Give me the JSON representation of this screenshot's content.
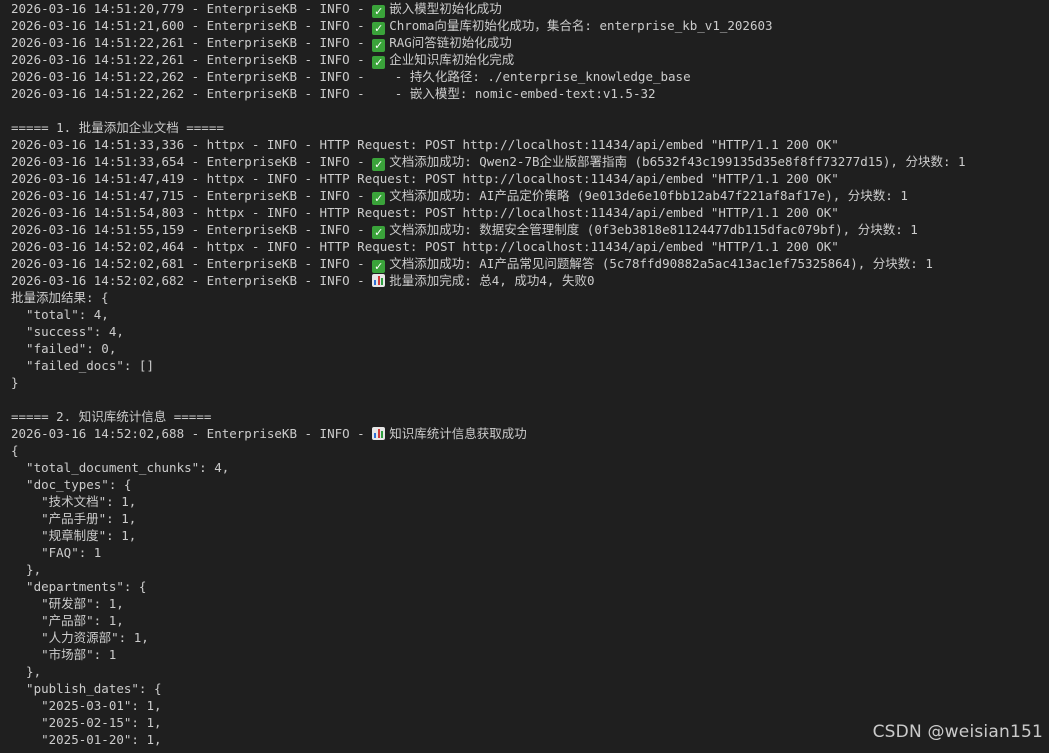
{
  "terminal": {
    "lines": [
      {
        "text": "2026-03-16 14:51:20,779 - EnterpriseKB - INFO - ",
        "icon": "check",
        "rest": "嵌入模型初始化成功"
      },
      {
        "text": "2026-03-16 14:51:21,600 - EnterpriseKB - INFO - ",
        "icon": "check",
        "rest": "Chroma向量库初始化成功，集合名: enterprise_kb_v1_202603"
      },
      {
        "text": "2026-03-16 14:51:22,261 - EnterpriseKB - INFO - ",
        "icon": "check",
        "rest": "RAG问答链初始化成功"
      },
      {
        "text": "2026-03-16 14:51:22,261 - EnterpriseKB - INFO - ",
        "icon": "check",
        "rest": "企业知识库初始化完成"
      },
      {
        "text": "2026-03-16 14:51:22,262 - EnterpriseKB - INFO -    - 持久化路径: ./enterprise_knowledge_base"
      },
      {
        "text": "2026-03-16 14:51:22,262 - EnterpriseKB - INFO -    - 嵌入模型: nomic-embed-text:v1.5-32"
      },
      {
        "text": ""
      },
      {
        "text": "===== 1. 批量添加企业文档 ====="
      },
      {
        "text": "2026-03-16 14:51:33,336 - httpx - INFO - HTTP Request: POST http://localhost:11434/api/embed \"HTTP/1.1 200 OK\""
      },
      {
        "text": "2026-03-16 14:51:33,654 - EnterpriseKB - INFO - ",
        "icon": "check",
        "rest": "文档添加成功: Qwen2-7B企业版部署指南 (b6532f43c199135d35e8f8ff73277d15), 分块数: 1"
      },
      {
        "text": "2026-03-16 14:51:47,419 - httpx - INFO - HTTP Request: POST http://localhost:11434/api/embed \"HTTP/1.1 200 OK\""
      },
      {
        "text": "2026-03-16 14:51:47,715 - EnterpriseKB - INFO - ",
        "icon": "check",
        "rest": "文档添加成功: AI产品定价策略 (9e013de6e10fbb12ab47f221af8af17e), 分块数: 1"
      },
      {
        "text": "2026-03-16 14:51:54,803 - httpx - INFO - HTTP Request: POST http://localhost:11434/api/embed \"HTTP/1.1 200 OK\""
      },
      {
        "text": "2026-03-16 14:51:55,159 - EnterpriseKB - INFO - ",
        "icon": "check",
        "rest": "文档添加成功: 数据安全管理制度 (0f3eb3818e81124477db115dfac079bf), 分块数: 1"
      },
      {
        "text": "2026-03-16 14:52:02,464 - httpx - INFO - HTTP Request: POST http://localhost:11434/api/embed \"HTTP/1.1 200 OK\""
      },
      {
        "text": "2026-03-16 14:52:02,681 - EnterpriseKB - INFO - ",
        "icon": "check",
        "rest": "文档添加成功: AI产品常见问题解答 (5c78ffd90882a5ac413ac1ef75325864), 分块数: 1"
      },
      {
        "text": "2026-03-16 14:52:02,682 - EnterpriseKB - INFO - ",
        "icon": "chart",
        "rest": "批量添加完成: 总4, 成功4, 失败0"
      },
      {
        "text": "批量添加结果: {"
      },
      {
        "text": "  \"total\": 4,"
      },
      {
        "text": "  \"success\": 4,"
      },
      {
        "text": "  \"failed\": 0,"
      },
      {
        "text": "  \"failed_docs\": []"
      },
      {
        "text": "}"
      },
      {
        "text": ""
      },
      {
        "text": "===== 2. 知识库统计信息 ====="
      },
      {
        "text": "2026-03-16 14:52:02,688 - EnterpriseKB - INFO - ",
        "icon": "chart",
        "rest": "知识库统计信息获取成功"
      },
      {
        "text": "{"
      },
      {
        "text": "  \"total_document_chunks\": 4,"
      },
      {
        "text": "  \"doc_types\": {"
      },
      {
        "text": "    \"技术文档\": 1,"
      },
      {
        "text": "    \"产品手册\": 1,"
      },
      {
        "text": "    \"规章制度\": 1,"
      },
      {
        "text": "    \"FAQ\": 1"
      },
      {
        "text": "  },"
      },
      {
        "text": "  \"departments\": {"
      },
      {
        "text": "    \"研发部\": 1,"
      },
      {
        "text": "    \"产品部\": 1,"
      },
      {
        "text": "    \"人力资源部\": 1,"
      },
      {
        "text": "    \"市场部\": 1"
      },
      {
        "text": "  },"
      },
      {
        "text": "  \"publish_dates\": {"
      },
      {
        "text": "    \"2025-03-01\": 1,"
      },
      {
        "text": "    \"2025-02-15\": 1,"
      },
      {
        "text": "    \"2025-01-20\": 1,"
      }
    ]
  },
  "watermark": {
    "text": "CSDN @weisian151"
  },
  "colors": {
    "background": "#1f1f1f",
    "text": "#cccccc",
    "check": "#3aa33a"
  }
}
